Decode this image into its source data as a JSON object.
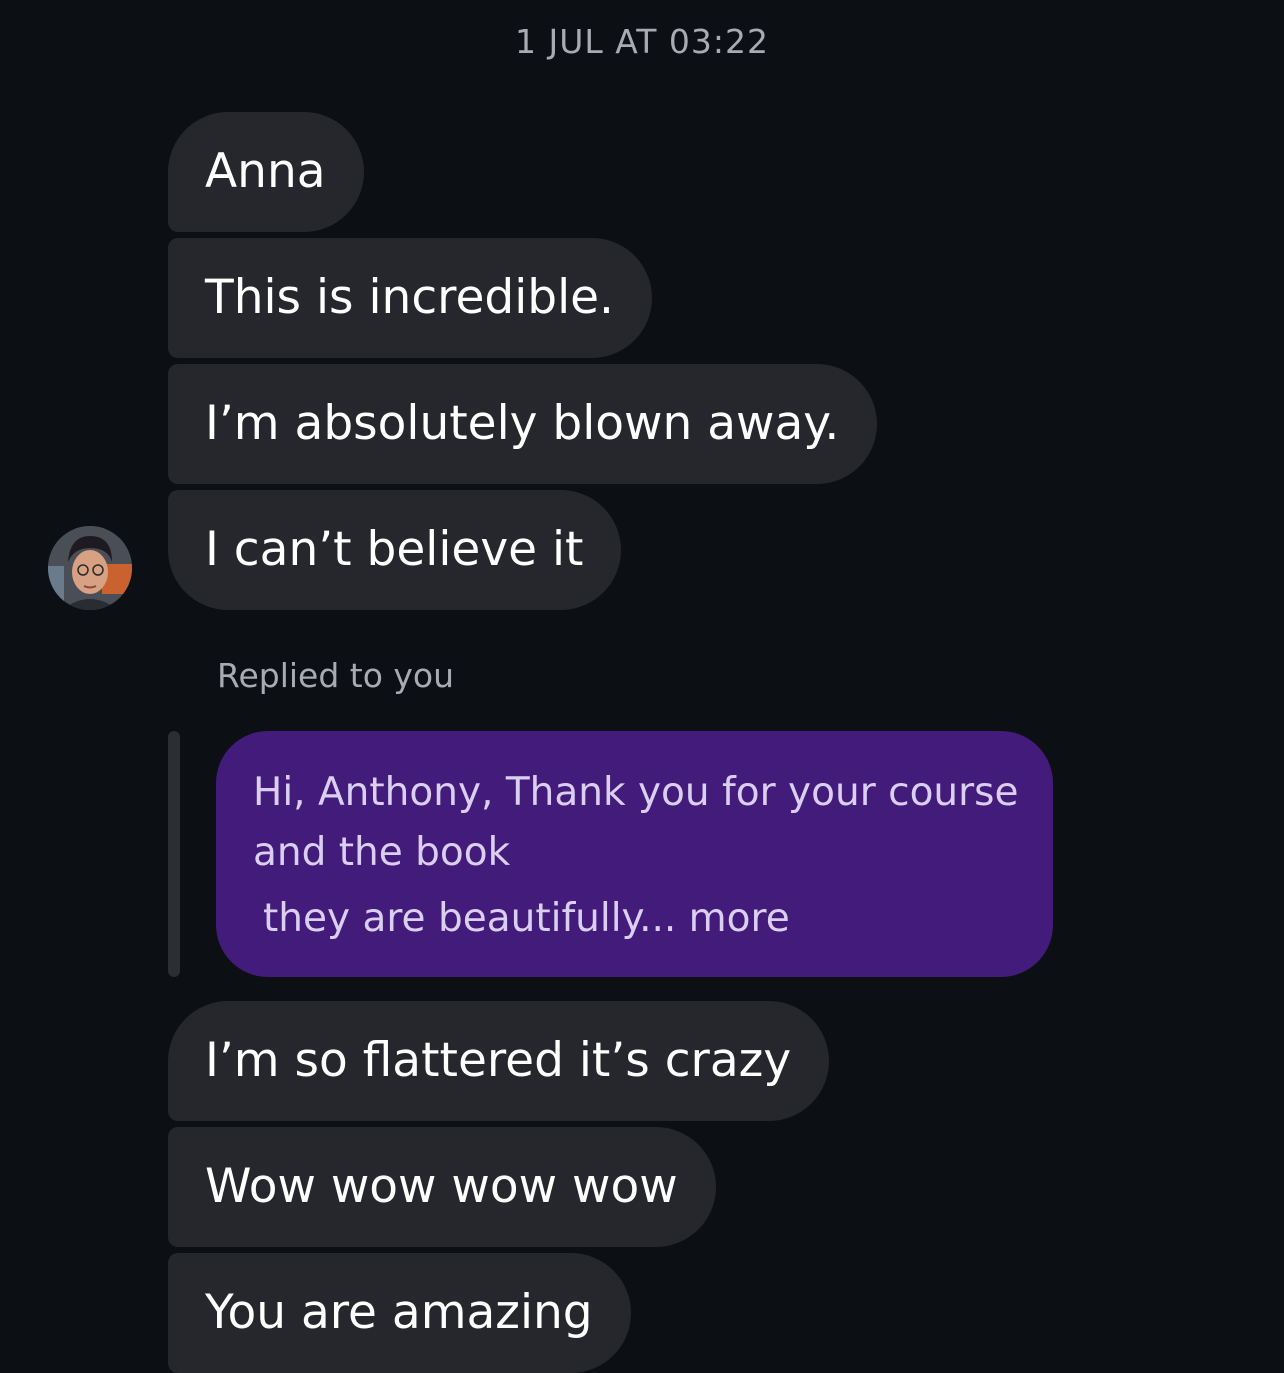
{
  "conversation": {
    "timestamp": "1 JUL AT 03:22",
    "messages_before": [
      "Anna",
      "This is incredible.",
      "I’m absolutely blown away.",
      "I can’t believe it"
    ],
    "reply": {
      "label": "Replied to you",
      "quoted_lines": [
        "Hi, Anthony, Thank you for your course",
        "and the book",
        "they are beautifully... more"
      ]
    },
    "messages_after": [
      "I’m so flattered it’s crazy",
      "Wow wow wow wow",
      "You are amazing"
    ]
  },
  "colors": {
    "background": "#0c0f14",
    "incoming_bubble": "#25272c",
    "quoted_bubble": "#431b7a",
    "muted_text": "#a8abb2"
  },
  "icons": {
    "avatar": "sender-avatar-photo"
  }
}
